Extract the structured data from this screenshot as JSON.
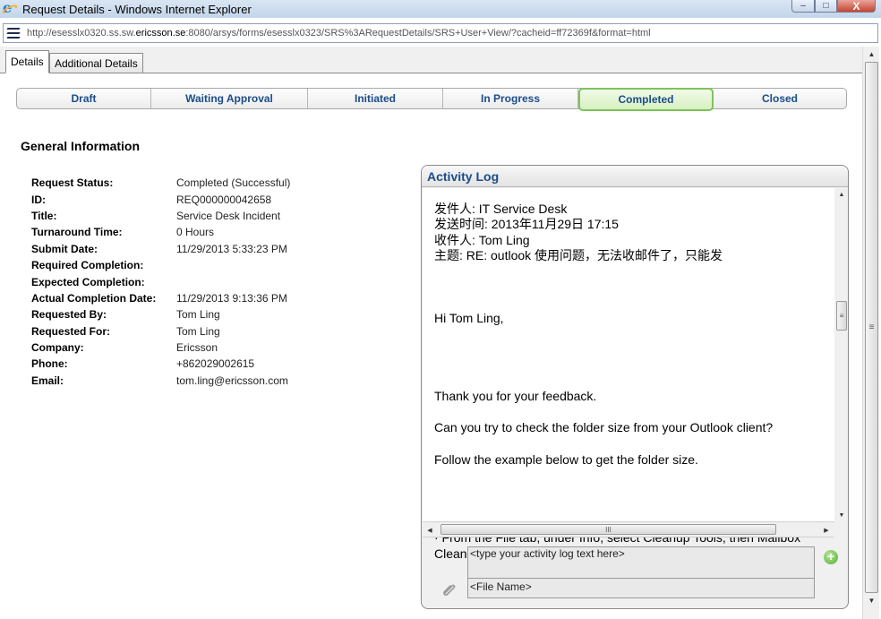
{
  "window": {
    "title": "Request Details - Windows Internet Explorer",
    "minimize_glyph": "–",
    "maximize_glyph": "□",
    "close_glyph": "X"
  },
  "address": {
    "url_prefix": "http://esesslx0320.ss.sw.",
    "url_domain": "ericsson.se",
    "url_suffix": ":8080/arsys/forms/esesslx0323/SRS%3ARequestDetails/SRS+User+View/?cacheid=ff72369f&format=html"
  },
  "tabs": [
    {
      "label": "Details",
      "active": true
    },
    {
      "label": "Additional Details",
      "active": false
    }
  ],
  "pipeline": [
    {
      "label": "Draft",
      "current": false
    },
    {
      "label": "Waiting Approval",
      "current": false
    },
    {
      "label": "Initiated",
      "current": false
    },
    {
      "label": "In Progress",
      "current": false
    },
    {
      "label": "Completed",
      "current": true
    },
    {
      "label": "Closed",
      "current": false
    }
  ],
  "general": {
    "title": "General Information",
    "fields": [
      {
        "label": "Request Status:",
        "value": "Completed (Successful)"
      },
      {
        "label": "ID:",
        "value": "REQ000000042658"
      },
      {
        "label": "Title:",
        "value": "Service Desk Incident"
      },
      {
        "label": "Turnaround Time:",
        "value": "0 Hours"
      },
      {
        "label": "Submit Date:",
        "value": "11/29/2013 5:33:23 PM"
      },
      {
        "label": "Required Completion:",
        "value": ""
      },
      {
        "label": "Expected Completion:",
        "value": ""
      },
      {
        "label": "Actual Completion Date:",
        "value": "11/29/2013 9:13:36 PM"
      },
      {
        "label": "Requested By:",
        "value": "Tom Ling"
      },
      {
        "label": "Requested For:",
        "value": "Tom Ling"
      },
      {
        "label": "Company:",
        "value": "Ericsson"
      },
      {
        "label": "Phone:",
        "value": "+862029002615"
      },
      {
        "label": "Email:",
        "value": "tom.ling@ericsson.com"
      }
    ]
  },
  "activity_log": {
    "title": "Activity Log",
    "header_lines": [
      "发件人: IT Service Desk",
      "发送时间: 2013年11月29日 17:15",
      "收件人: Tom Ling",
      "主题: RE: outlook 使用问题，无法收邮件了，只能发"
    ],
    "greeting": "Hi Tom Ling,",
    "body_lines": [
      "Thank you for your feedback.",
      "Can you try to check the folder size from your Outlook client?",
      "Follow the example below to get the folder size."
    ],
    "bullet": "·   From the File tab, under Info, select Cleanup Tools, then Mailbox Cleanup...",
    "input_placeholder": "<type your activity log text here>",
    "file_placeholder": "<File Name>",
    "add_glyph": "+"
  },
  "scroll": {
    "up": "▲",
    "down": "▼",
    "left": "◀",
    "right": "▶",
    "grip_v": "≡",
    "grip_h": "III"
  },
  "icons": {
    "browser": "ie-icon",
    "site": "ericsson-logo-icon",
    "attach": "paperclip-icon",
    "add": "add-icon"
  }
}
